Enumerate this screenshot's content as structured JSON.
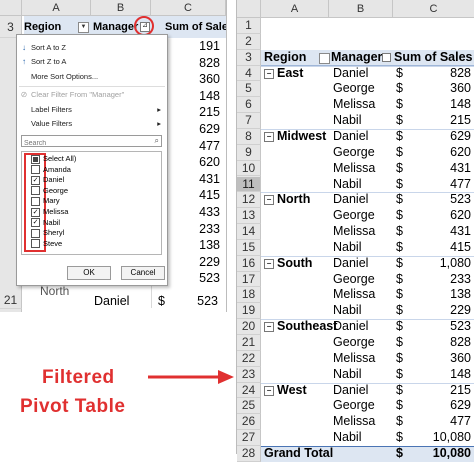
{
  "left_sheet": {
    "columns": [
      "A",
      "B",
      "C"
    ],
    "header_row": {
      "row_number": "3",
      "region": "Region",
      "manager": "Manager",
      "sum": "Sum of Sales"
    },
    "visible_values": [
      "191",
      "828",
      "360",
      "148",
      "215",
      "629",
      "477",
      "620",
      "431",
      "415",
      "433",
      "233",
      "138",
      "229",
      "523"
    ],
    "bottom_row": {
      "row_number": "21",
      "region": "North",
      "manager": "Daniel",
      "currency": "$",
      "value": "523"
    }
  },
  "filter_menu": {
    "sort_a_z": "Sort A to Z",
    "sort_z_a": "Sort Z to A",
    "more_sort": "More Sort Options...",
    "clear_filter": "Clear Filter From \"Manager\"",
    "label_filters": "Label Filters",
    "value_filters": "Value Filters",
    "search_placeholder": "Search",
    "items": [
      {
        "label": "Select All)",
        "state": "partial"
      },
      {
        "label": "Amanda",
        "state": "unchecked"
      },
      {
        "label": "Daniel",
        "state": "checked"
      },
      {
        "label": "George",
        "state": "unchecked"
      },
      {
        "label": "Mary",
        "state": "unchecked"
      },
      {
        "label": "Melissa",
        "state": "checked"
      },
      {
        "label": "Nabil",
        "state": "checked"
      },
      {
        "label": "Sheryl",
        "state": "unchecked"
      },
      {
        "label": "Steve",
        "state": "unchecked"
      }
    ],
    "ok_label": "OK",
    "cancel_label": "Cancel"
  },
  "annotation": {
    "line1": "Filtered",
    "line2": "Pivot Table",
    "color": "#e03030"
  },
  "right_sheet": {
    "columns": [
      "A",
      "B",
      "C"
    ],
    "empty_rows": [
      "1",
      "2"
    ],
    "header_row": {
      "row_number": "3",
      "region": "Region",
      "manager": "Manager",
      "sum": "Sum of Sales"
    },
    "rows": [
      {
        "row": "4",
        "region": "East",
        "manager": "Daniel",
        "currency": "$",
        "value": "828"
      },
      {
        "row": "5",
        "region": "",
        "manager": "George",
        "currency": "$",
        "value": "360"
      },
      {
        "row": "6",
        "region": "",
        "manager": "Melissa",
        "currency": "$",
        "value": "148"
      },
      {
        "row": "7",
        "region": "",
        "manager": "Nabil",
        "currency": "$",
        "value": "215"
      },
      {
        "row": "8",
        "region": "Midwest",
        "manager": "Daniel",
        "currency": "$",
        "value": "629"
      },
      {
        "row": "9",
        "region": "",
        "manager": "George",
        "currency": "$",
        "value": "620"
      },
      {
        "row": "10",
        "region": "",
        "manager": "Melissa",
        "currency": "$",
        "value": "431"
      },
      {
        "row": "11",
        "region": "",
        "manager": "Nabil",
        "currency": "$",
        "value": "477"
      },
      {
        "row": "12",
        "region": "North",
        "manager": "Daniel",
        "currency": "$",
        "value": "523"
      },
      {
        "row": "13",
        "region": "",
        "manager": "George",
        "currency": "$",
        "value": "620"
      },
      {
        "row": "14",
        "region": "",
        "manager": "Melissa",
        "currency": "$",
        "value": "431"
      },
      {
        "row": "15",
        "region": "",
        "manager": "Nabil",
        "currency": "$",
        "value": "415"
      },
      {
        "row": "16",
        "region": "South",
        "manager": "Daniel",
        "currency": "$",
        "value": "1,080"
      },
      {
        "row": "17",
        "region": "",
        "manager": "George",
        "currency": "$",
        "value": "233"
      },
      {
        "row": "18",
        "region": "",
        "manager": "Melissa",
        "currency": "$",
        "value": "138"
      },
      {
        "row": "19",
        "region": "",
        "manager": "Nabil",
        "currency": "$",
        "value": "229"
      },
      {
        "row": "20",
        "region": "Southeast",
        "manager": "Daniel",
        "currency": "$",
        "value": "523"
      },
      {
        "row": "21",
        "region": "",
        "manager": "George",
        "currency": "$",
        "value": "828"
      },
      {
        "row": "22",
        "region": "",
        "manager": "Melissa",
        "currency": "$",
        "value": "360"
      },
      {
        "row": "23",
        "region": "",
        "manager": "Nabil",
        "currency": "$",
        "value": "148"
      },
      {
        "row": "24",
        "region": "West",
        "manager": "Daniel",
        "currency": "$",
        "value": "215"
      },
      {
        "row": "25",
        "region": "",
        "manager": "George",
        "currency": "$",
        "value": "629"
      },
      {
        "row": "26",
        "region": "",
        "manager": "Melissa",
        "currency": "$",
        "value": "477"
      },
      {
        "row": "27",
        "region": "",
        "manager": "Nabil",
        "currency": "$",
        "value": "10,080"
      }
    ],
    "grand_total": {
      "row": "28",
      "label": "Grand Total",
      "currency": "$",
      "value": "10,080"
    },
    "selected_row": "11"
  }
}
